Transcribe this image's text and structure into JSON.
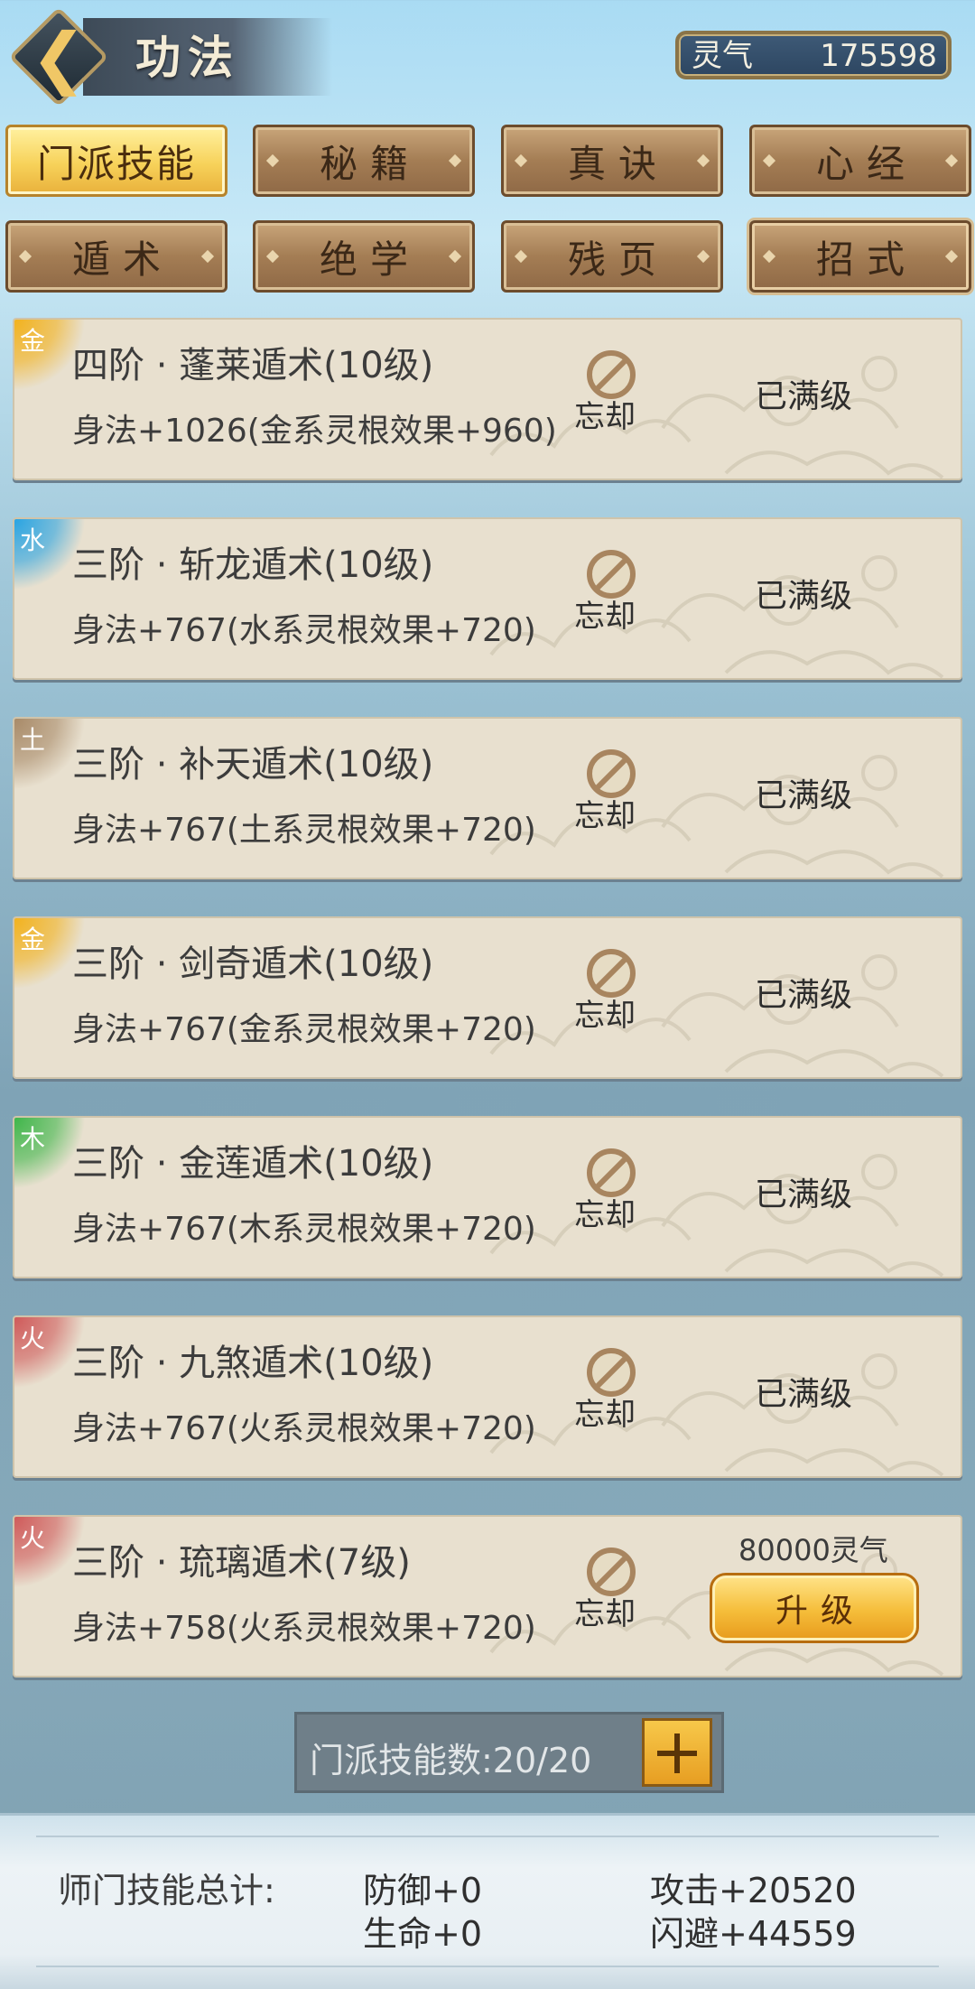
{
  "header": {
    "title": "功法",
    "currency_label": "灵气",
    "currency_value": "175598"
  },
  "tabs": [
    {
      "label": "门派技能",
      "active": true
    },
    {
      "label": "秘籍",
      "active": false
    },
    {
      "label": "真诀",
      "active": false
    },
    {
      "label": "心经",
      "active": false
    },
    {
      "label": "遁术",
      "active": false
    },
    {
      "label": "绝学",
      "active": false
    },
    {
      "label": "残页",
      "active": false
    },
    {
      "label": "招式",
      "active": false
    }
  ],
  "skills": [
    {
      "element": "金",
      "element_color": "#f2b21e",
      "name": "四阶 · 蓬莱遁术(10级)",
      "desc": "身法+1026(金系灵根效果+960)",
      "forget": "忘却",
      "status": "已满级"
    },
    {
      "element": "水",
      "element_color": "#2aa4e2",
      "name": "三阶 · 斩龙遁术(10级)",
      "desc": "身法+767(水系灵根效果+720)",
      "forget": "忘却",
      "status": "已满级"
    },
    {
      "element": "土",
      "element_color": "#a88a68",
      "name": "三阶 · 补天遁术(10级)",
      "desc": "身法+767(土系灵根效果+720)",
      "forget": "忘却",
      "status": "已满级"
    },
    {
      "element": "金",
      "element_color": "#f2b21e",
      "name": "三阶 · 剑奇遁术(10级)",
      "desc": "身法+767(金系灵根效果+720)",
      "forget": "忘却",
      "status": "已满级"
    },
    {
      "element": "木",
      "element_color": "#3fb64a",
      "name": "三阶 · 金莲遁术(10级)",
      "desc": "身法+767(木系灵根效果+720)",
      "forget": "忘却",
      "status": "已满级"
    },
    {
      "element": "火",
      "element_color": "#cf5a5a",
      "name": "三阶 · 九煞遁术(10级)",
      "desc": "身法+767(火系灵根效果+720)",
      "forget": "忘却",
      "status": "已满级"
    },
    {
      "element": "火",
      "element_color": "#cf5a5a",
      "name": "三阶 · 琉璃遁术(7级)",
      "desc": "身法+758(火系灵根效果+720)",
      "forget": "忘却",
      "cost": "80000灵气",
      "upgrade_label": "升级"
    }
  ],
  "skill_count_text": "门派技能数:20/20",
  "summary": {
    "label": "师门技能总计:",
    "defense": "防御+0",
    "life": "生命+0",
    "attack": "攻击+20520",
    "dodge": "闪避+44559"
  }
}
